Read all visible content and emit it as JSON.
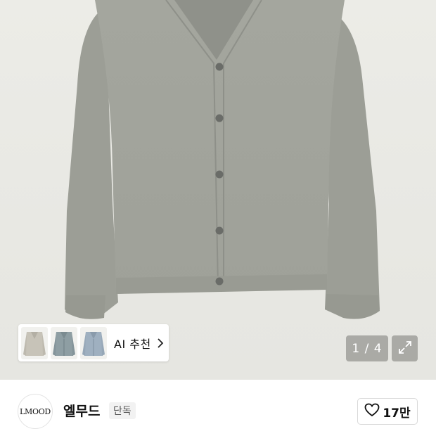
{
  "gallery": {
    "image_alt": "gray v-neck button cardigan",
    "counter": "1 / 4",
    "expand_icon": "expand-icon"
  },
  "ai_recommend": {
    "label": "AI 추천",
    "chevron_icon": "chevron-right-icon",
    "thumbnails": [
      {
        "name": "beige-cardigan-thumb"
      },
      {
        "name": "blue-gray-cardigan-thumb"
      },
      {
        "name": "light-blue-cardigan-thumb"
      }
    ]
  },
  "brand": {
    "logo_text": "LMOOD",
    "name": "엘무드",
    "badge": "단독"
  },
  "like": {
    "icon": "heart-icon",
    "count": "17만"
  },
  "colors": {
    "cardigan": "#a3a59d",
    "button_overlay": "#787874"
  }
}
